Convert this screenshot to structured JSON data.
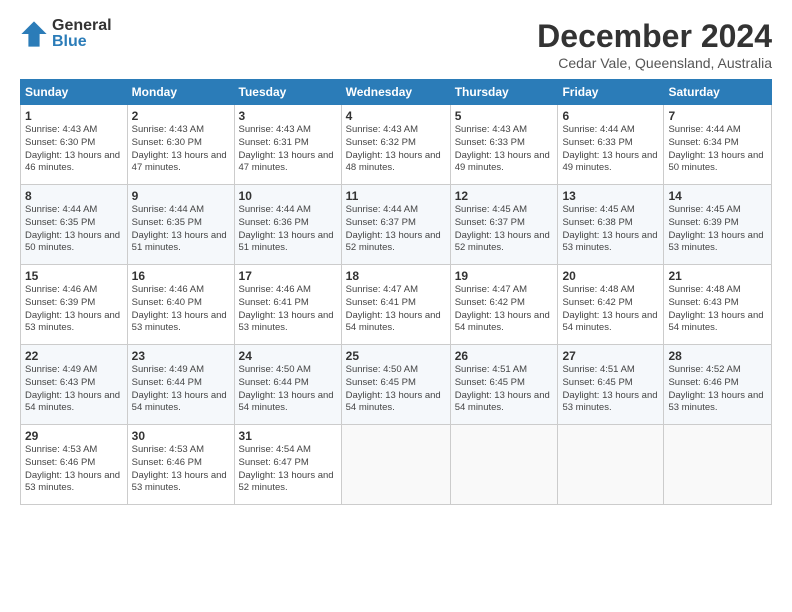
{
  "header": {
    "logo_general": "General",
    "logo_blue": "Blue",
    "month_title": "December 2024",
    "location": "Cedar Vale, Queensland, Australia"
  },
  "days_of_week": [
    "Sunday",
    "Monday",
    "Tuesday",
    "Wednesday",
    "Thursday",
    "Friday",
    "Saturday"
  ],
  "weeks": [
    [
      {
        "day": 1,
        "sunrise": "4:43 AM",
        "sunset": "6:30 PM",
        "daylight": "13 hours and 46 minutes."
      },
      {
        "day": 2,
        "sunrise": "4:43 AM",
        "sunset": "6:30 PM",
        "daylight": "13 hours and 47 minutes."
      },
      {
        "day": 3,
        "sunrise": "4:43 AM",
        "sunset": "6:31 PM",
        "daylight": "13 hours and 47 minutes."
      },
      {
        "day": 4,
        "sunrise": "4:43 AM",
        "sunset": "6:32 PM",
        "daylight": "13 hours and 48 minutes."
      },
      {
        "day": 5,
        "sunrise": "4:43 AM",
        "sunset": "6:33 PM",
        "daylight": "13 hours and 49 minutes."
      },
      {
        "day": 6,
        "sunrise": "4:44 AM",
        "sunset": "6:33 PM",
        "daylight": "13 hours and 49 minutes."
      },
      {
        "day": 7,
        "sunrise": "4:44 AM",
        "sunset": "6:34 PM",
        "daylight": "13 hours and 50 minutes."
      }
    ],
    [
      {
        "day": 8,
        "sunrise": "4:44 AM",
        "sunset": "6:35 PM",
        "daylight": "13 hours and 50 minutes."
      },
      {
        "day": 9,
        "sunrise": "4:44 AM",
        "sunset": "6:35 PM",
        "daylight": "13 hours and 51 minutes."
      },
      {
        "day": 10,
        "sunrise": "4:44 AM",
        "sunset": "6:36 PM",
        "daylight": "13 hours and 51 minutes."
      },
      {
        "day": 11,
        "sunrise": "4:44 AM",
        "sunset": "6:37 PM",
        "daylight": "13 hours and 52 minutes."
      },
      {
        "day": 12,
        "sunrise": "4:45 AM",
        "sunset": "6:37 PM",
        "daylight": "13 hours and 52 minutes."
      },
      {
        "day": 13,
        "sunrise": "4:45 AM",
        "sunset": "6:38 PM",
        "daylight": "13 hours and 53 minutes."
      },
      {
        "day": 14,
        "sunrise": "4:45 AM",
        "sunset": "6:39 PM",
        "daylight": "13 hours and 53 minutes."
      }
    ],
    [
      {
        "day": 15,
        "sunrise": "4:46 AM",
        "sunset": "6:39 PM",
        "daylight": "13 hours and 53 minutes."
      },
      {
        "day": 16,
        "sunrise": "4:46 AM",
        "sunset": "6:40 PM",
        "daylight": "13 hours and 53 minutes."
      },
      {
        "day": 17,
        "sunrise": "4:46 AM",
        "sunset": "6:41 PM",
        "daylight": "13 hours and 53 minutes."
      },
      {
        "day": 18,
        "sunrise": "4:47 AM",
        "sunset": "6:41 PM",
        "daylight": "13 hours and 54 minutes."
      },
      {
        "day": 19,
        "sunrise": "4:47 AM",
        "sunset": "6:42 PM",
        "daylight": "13 hours and 54 minutes."
      },
      {
        "day": 20,
        "sunrise": "4:48 AM",
        "sunset": "6:42 PM",
        "daylight": "13 hours and 54 minutes."
      },
      {
        "day": 21,
        "sunrise": "4:48 AM",
        "sunset": "6:43 PM",
        "daylight": "13 hours and 54 minutes."
      }
    ],
    [
      {
        "day": 22,
        "sunrise": "4:49 AM",
        "sunset": "6:43 PM",
        "daylight": "13 hours and 54 minutes."
      },
      {
        "day": 23,
        "sunrise": "4:49 AM",
        "sunset": "6:44 PM",
        "daylight": "13 hours and 54 minutes."
      },
      {
        "day": 24,
        "sunrise": "4:50 AM",
        "sunset": "6:44 PM",
        "daylight": "13 hours and 54 minutes."
      },
      {
        "day": 25,
        "sunrise": "4:50 AM",
        "sunset": "6:45 PM",
        "daylight": "13 hours and 54 minutes."
      },
      {
        "day": 26,
        "sunrise": "4:51 AM",
        "sunset": "6:45 PM",
        "daylight": "13 hours and 54 minutes."
      },
      {
        "day": 27,
        "sunrise": "4:51 AM",
        "sunset": "6:45 PM",
        "daylight": "13 hours and 53 minutes."
      },
      {
        "day": 28,
        "sunrise": "4:52 AM",
        "sunset": "6:46 PM",
        "daylight": "13 hours and 53 minutes."
      }
    ],
    [
      {
        "day": 29,
        "sunrise": "4:53 AM",
        "sunset": "6:46 PM",
        "daylight": "13 hours and 53 minutes."
      },
      {
        "day": 30,
        "sunrise": "4:53 AM",
        "sunset": "6:46 PM",
        "daylight": "13 hours and 53 minutes."
      },
      {
        "day": 31,
        "sunrise": "4:54 AM",
        "sunset": "6:47 PM",
        "daylight": "13 hours and 52 minutes."
      },
      null,
      null,
      null,
      null
    ]
  ]
}
